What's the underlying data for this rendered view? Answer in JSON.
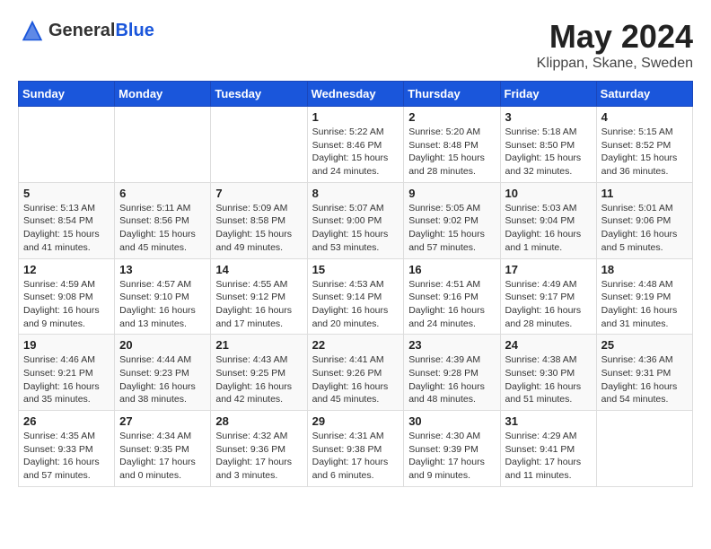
{
  "header": {
    "logo": {
      "text_general": "General",
      "text_blue": "Blue"
    },
    "month": "May 2024",
    "location": "Klippan, Skane, Sweden"
  },
  "weekdays": [
    "Sunday",
    "Monday",
    "Tuesday",
    "Wednesday",
    "Thursday",
    "Friday",
    "Saturday"
  ],
  "weeks": [
    [
      {
        "day": "",
        "info": ""
      },
      {
        "day": "",
        "info": ""
      },
      {
        "day": "",
        "info": ""
      },
      {
        "day": "1",
        "info": "Sunrise: 5:22 AM\nSunset: 8:46 PM\nDaylight: 15 hours and 24 minutes."
      },
      {
        "day": "2",
        "info": "Sunrise: 5:20 AM\nSunset: 8:48 PM\nDaylight: 15 hours and 28 minutes."
      },
      {
        "day": "3",
        "info": "Sunrise: 5:18 AM\nSunset: 8:50 PM\nDaylight: 15 hours and 32 minutes."
      },
      {
        "day": "4",
        "info": "Sunrise: 5:15 AM\nSunset: 8:52 PM\nDaylight: 15 hours and 36 minutes."
      }
    ],
    [
      {
        "day": "5",
        "info": "Sunrise: 5:13 AM\nSunset: 8:54 PM\nDaylight: 15 hours and 41 minutes."
      },
      {
        "day": "6",
        "info": "Sunrise: 5:11 AM\nSunset: 8:56 PM\nDaylight: 15 hours and 45 minutes."
      },
      {
        "day": "7",
        "info": "Sunrise: 5:09 AM\nSunset: 8:58 PM\nDaylight: 15 hours and 49 minutes."
      },
      {
        "day": "8",
        "info": "Sunrise: 5:07 AM\nSunset: 9:00 PM\nDaylight: 15 hours and 53 minutes."
      },
      {
        "day": "9",
        "info": "Sunrise: 5:05 AM\nSunset: 9:02 PM\nDaylight: 15 hours and 57 minutes."
      },
      {
        "day": "10",
        "info": "Sunrise: 5:03 AM\nSunset: 9:04 PM\nDaylight: 16 hours and 1 minute."
      },
      {
        "day": "11",
        "info": "Sunrise: 5:01 AM\nSunset: 9:06 PM\nDaylight: 16 hours and 5 minutes."
      }
    ],
    [
      {
        "day": "12",
        "info": "Sunrise: 4:59 AM\nSunset: 9:08 PM\nDaylight: 16 hours and 9 minutes."
      },
      {
        "day": "13",
        "info": "Sunrise: 4:57 AM\nSunset: 9:10 PM\nDaylight: 16 hours and 13 minutes."
      },
      {
        "day": "14",
        "info": "Sunrise: 4:55 AM\nSunset: 9:12 PM\nDaylight: 16 hours and 17 minutes."
      },
      {
        "day": "15",
        "info": "Sunrise: 4:53 AM\nSunset: 9:14 PM\nDaylight: 16 hours and 20 minutes."
      },
      {
        "day": "16",
        "info": "Sunrise: 4:51 AM\nSunset: 9:16 PM\nDaylight: 16 hours and 24 minutes."
      },
      {
        "day": "17",
        "info": "Sunrise: 4:49 AM\nSunset: 9:17 PM\nDaylight: 16 hours and 28 minutes."
      },
      {
        "day": "18",
        "info": "Sunrise: 4:48 AM\nSunset: 9:19 PM\nDaylight: 16 hours and 31 minutes."
      }
    ],
    [
      {
        "day": "19",
        "info": "Sunrise: 4:46 AM\nSunset: 9:21 PM\nDaylight: 16 hours and 35 minutes."
      },
      {
        "day": "20",
        "info": "Sunrise: 4:44 AM\nSunset: 9:23 PM\nDaylight: 16 hours and 38 minutes."
      },
      {
        "day": "21",
        "info": "Sunrise: 4:43 AM\nSunset: 9:25 PM\nDaylight: 16 hours and 42 minutes."
      },
      {
        "day": "22",
        "info": "Sunrise: 4:41 AM\nSunset: 9:26 PM\nDaylight: 16 hours and 45 minutes."
      },
      {
        "day": "23",
        "info": "Sunrise: 4:39 AM\nSunset: 9:28 PM\nDaylight: 16 hours and 48 minutes."
      },
      {
        "day": "24",
        "info": "Sunrise: 4:38 AM\nSunset: 9:30 PM\nDaylight: 16 hours and 51 minutes."
      },
      {
        "day": "25",
        "info": "Sunrise: 4:36 AM\nSunset: 9:31 PM\nDaylight: 16 hours and 54 minutes."
      }
    ],
    [
      {
        "day": "26",
        "info": "Sunrise: 4:35 AM\nSunset: 9:33 PM\nDaylight: 16 hours and 57 minutes."
      },
      {
        "day": "27",
        "info": "Sunrise: 4:34 AM\nSunset: 9:35 PM\nDaylight: 17 hours and 0 minutes."
      },
      {
        "day": "28",
        "info": "Sunrise: 4:32 AM\nSunset: 9:36 PM\nDaylight: 17 hours and 3 minutes."
      },
      {
        "day": "29",
        "info": "Sunrise: 4:31 AM\nSunset: 9:38 PM\nDaylight: 17 hours and 6 minutes."
      },
      {
        "day": "30",
        "info": "Sunrise: 4:30 AM\nSunset: 9:39 PM\nDaylight: 17 hours and 9 minutes."
      },
      {
        "day": "31",
        "info": "Sunrise: 4:29 AM\nSunset: 9:41 PM\nDaylight: 17 hours and 11 minutes."
      },
      {
        "day": "",
        "info": ""
      }
    ]
  ]
}
